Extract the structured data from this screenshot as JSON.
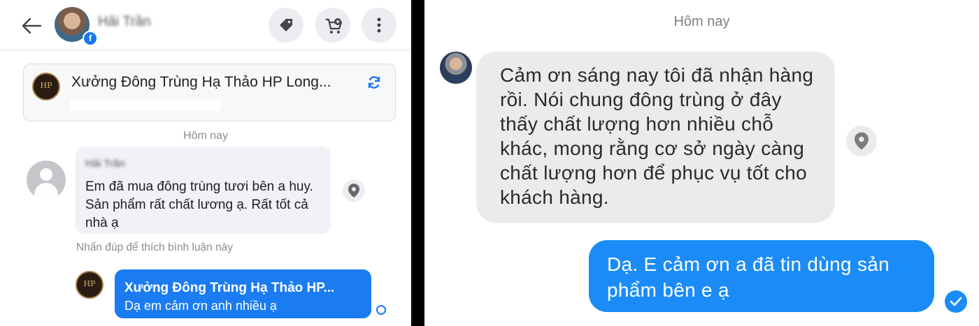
{
  "left": {
    "header": {
      "contact_name": "Hải Trần",
      "badge": "f"
    },
    "page_card": {
      "name": "Xưởng Đông Trùng Hạ Thảo HP Long..."
    },
    "date_separator": "Hôm nay",
    "comment": {
      "author": "Hải Trần",
      "text": "Em đã mua đông trùng tươi  bên a huy. Sản phẩm rất chất lương ạ. Rất  tốt  cả nhà  ạ"
    },
    "hint": "Nhấn đúp để thích bình luận này",
    "reply": {
      "name": "Xưởng Đông Trùng Hạ Thảo HP...",
      "text": "Dạ em cảm ơn anh nhiều ạ"
    }
  },
  "right": {
    "date_separator": "Hôm nay",
    "message_received": "Cảm ơn sáng nay tôi đã nhận hàng rồi. Nói chung đông trùng ở đây thấy chất lượng hơn nhiều chỗ khác, mong rằng cơ sở ngày càng chất lượng hơn để phục vụ tốt cho khách hàng.",
    "message_sent": "Dạ. E cảm ơn a đã tin dùng sản phẩm bên e ạ"
  },
  "colors": {
    "messenger_blue": "#1b7cf2",
    "bubble_gray": "#f0f2f5",
    "icon_button_bg": "#ebedf0"
  },
  "icons": [
    "back-arrow-icon",
    "tag-icon",
    "cart-add-icon",
    "more-vertical-icon",
    "refresh-icon",
    "location-pin-icon",
    "facebook-icon",
    "check-icon"
  ]
}
